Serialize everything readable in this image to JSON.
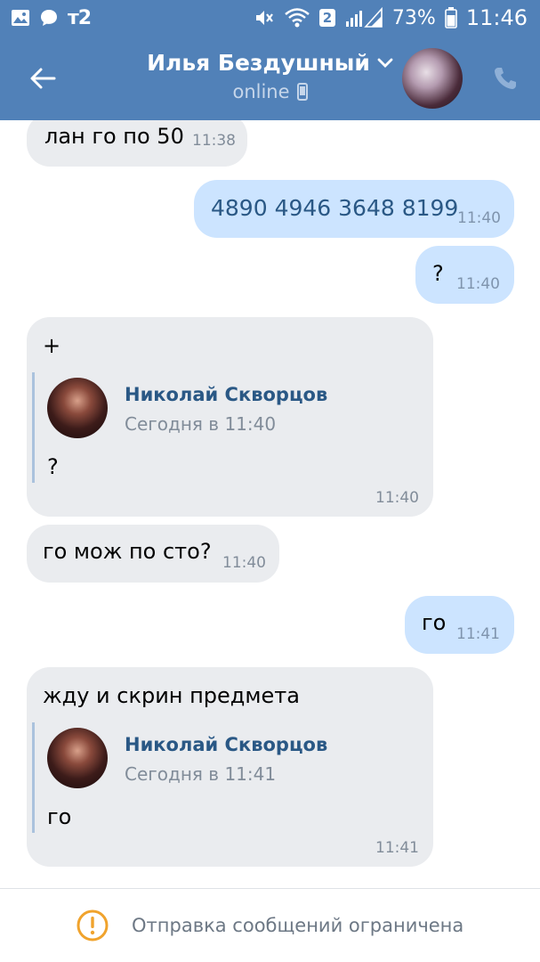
{
  "status_bar": {
    "carrier": "т2",
    "sim_badge": "2",
    "battery_percent": "73%",
    "time": "11:46",
    "icons": [
      "gallery-icon",
      "chat-icon",
      "mute-icon",
      "wifi-icon",
      "signal-icon",
      "battery-icon"
    ]
  },
  "header": {
    "contact_name": "Илья Бездушный",
    "status": "online",
    "icons": [
      "back-arrow-icon",
      "chevron-down-icon",
      "mobile-device-icon",
      "phone-icon"
    ]
  },
  "messages": [
    {
      "direction": "in",
      "text": "лан го по 50",
      "time": "11:38"
    },
    {
      "direction": "out",
      "text": "4890 4946 3648 8199",
      "time": "11:40"
    },
    {
      "direction": "out",
      "text": "?",
      "time": "11:40"
    },
    {
      "direction": "in",
      "text": "+",
      "time": "11:40",
      "forwarded": {
        "author": "Николай Скворцов",
        "date": "Сегодня в 11:40",
        "text": "?"
      }
    },
    {
      "direction": "in",
      "text": "го мож по сто?",
      "time": "11:40"
    },
    {
      "direction": "out",
      "text": "го",
      "time": "11:41"
    },
    {
      "direction": "in",
      "text": "жду и скрин предмета",
      "time": "11:41",
      "forwarded": {
        "author": "Николай Скворцов",
        "date": "Сегодня в 11:41",
        "text": "го"
      }
    }
  ],
  "bottom_bar": {
    "notice": "Отправка сообщений ограничена",
    "accent_color": "#f0a32d"
  },
  "colors": {
    "header_blue": "#5181b8",
    "incoming_bubble": "#eaecef",
    "outgoing_bubble": "#cce4ff",
    "link_blue": "#2a5885"
  }
}
